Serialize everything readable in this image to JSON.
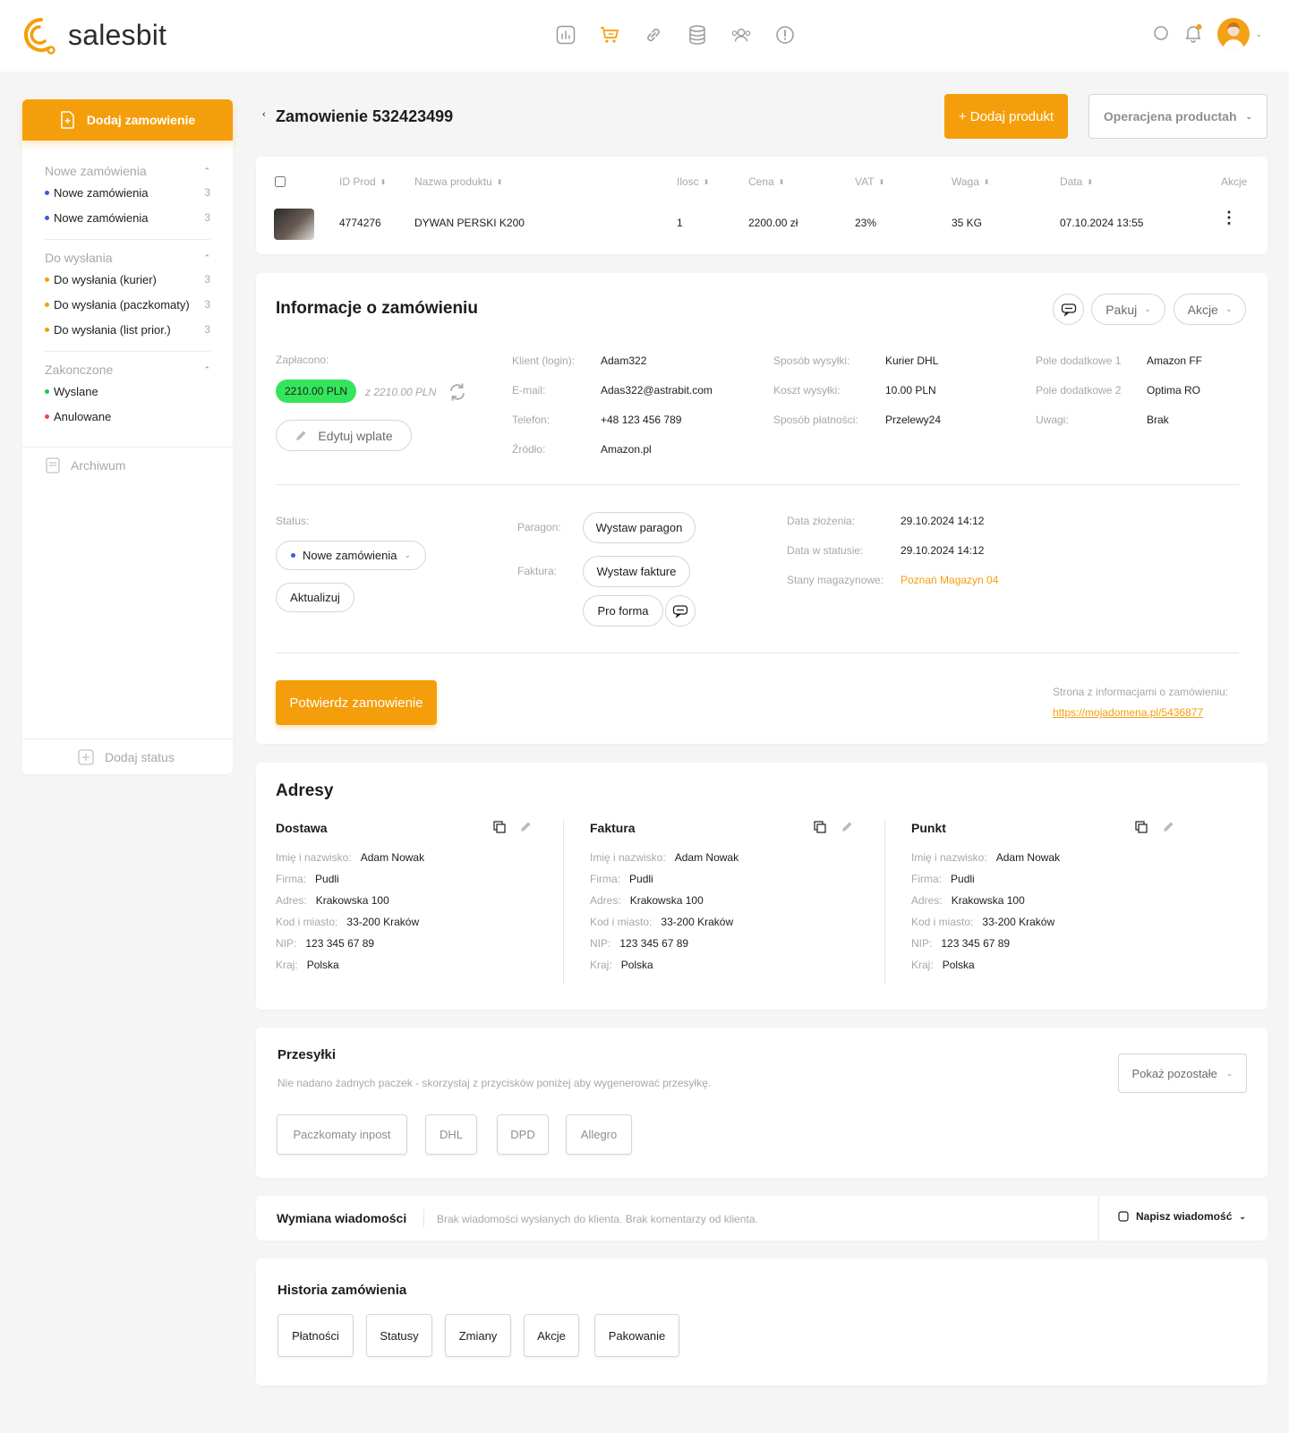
{
  "header": {
    "logo_text": "salesbit",
    "nav_icons": [
      "chart-icon",
      "cart-icon",
      "link-icon",
      "database-icon",
      "users-icon",
      "alert-icon"
    ]
  },
  "sidebar": {
    "add_order": "Dodaj zamowienie",
    "groups": [
      {
        "title": "Nowe zamówienia",
        "items": [
          {
            "label": "Nowe zamówienia",
            "count": "3",
            "color": "#3b5bdb"
          },
          {
            "label": "Nowe zamówienia",
            "count": "3",
            "color": "#3b5bdb"
          }
        ]
      },
      {
        "title": "Do wysłania",
        "items": [
          {
            "label": "Do wysłania (kurier)",
            "count": "3",
            "color": "#f59e0b"
          },
          {
            "label": "Do wysłania (paczkomaty)",
            "count": "3",
            "color": "#f59e0b"
          },
          {
            "label": "Do wysłania (list prior.)",
            "count": "3",
            "color": "#f59e0b"
          }
        ]
      },
      {
        "title": "Zakonczone",
        "items": [
          {
            "label": "Wyslane",
            "count": "",
            "color": "#22c55e"
          },
          {
            "label": "Anulowane",
            "count": "",
            "color": "#ef4444"
          }
        ]
      }
    ],
    "archive": "Archiwum",
    "add_status": "Dodaj status"
  },
  "page": {
    "title": "Zamowienie 532423499",
    "add_product": "+ Dodaj produkt",
    "operations": "Operacjena productah"
  },
  "products": {
    "columns": [
      "ID Prod",
      "Nazwa produktu",
      "Ilosc",
      "Cena",
      "VAT",
      "Waga",
      "Data",
      "Akcje"
    ],
    "rows": [
      {
        "id": "4774276",
        "name": "DYWAN PERSKI K200",
        "qty": "1",
        "price": "2200.00 zł",
        "vat": "23%",
        "weight": "35 KG",
        "date": "07.10.2024 13:55"
      }
    ]
  },
  "info": {
    "title": "Informacje o zamówieniu",
    "pack": "Pakuj",
    "actions": "Akcje",
    "paid_label": "Zapłacono:",
    "paid_amount": "2210.00 PLN",
    "paid_of": "z 2210.00 PLN",
    "edit_payment": "Edytuj wplate",
    "col2": [
      {
        "k": "Klient (login):",
        "v": "Adam322"
      },
      {
        "k": "E-mail:",
        "v": "Adas322@astrabit.com"
      },
      {
        "k": "Telefon:",
        "v": "+48 123 456 789"
      },
      {
        "k": "Źródło:",
        "v": "Amazon.pl"
      }
    ],
    "col3": [
      {
        "k": "Sposób wysyłki:",
        "v": "Kurier DHL"
      },
      {
        "k": "Koszt wysyłki:",
        "v": "10.00 PLN"
      },
      {
        "k": "Sposób płatności:",
        "v": "Przelewy24"
      }
    ],
    "col4": [
      {
        "k": "Pole dodatkowe 1",
        "v": "Amazon FF"
      },
      {
        "k": "Pole dodatkowe 2",
        "v": "Optima RO"
      },
      {
        "k": "Uwagi:",
        "v": "Brak"
      }
    ],
    "status_label": "Status:",
    "status_value": "Nowe zamówienia",
    "update": "Aktualizuj",
    "receipt_label": "Paragon:",
    "receipt_btn": "Wystaw paragon",
    "invoice_label": "Faktura:",
    "invoice_btn": "Wystaw fakture",
    "proforma_btn": "Pro forma",
    "dates": [
      {
        "k": "Data złożenia:",
        "v": "29.10.2024 14:12"
      },
      {
        "k": "Data w statusie:",
        "v": "29.10.2024 14:12"
      },
      {
        "k": "Stany magazynowe:",
        "v": "Poznań Magazyn 04"
      }
    ],
    "confirm": "Potwierdz zamowienie",
    "info_page_label": "Strona z informacjami o zamówieniu:",
    "info_page_url": "https://mojadomena.pl/5436877"
  },
  "addresses": {
    "title": "Adresy",
    "blocks": [
      {
        "title": "Dostawa",
        "rows": [
          {
            "k": "Imię i nazwisko:",
            "v": "Adam Nowak"
          },
          {
            "k": "Firma:",
            "v": "Pudli"
          },
          {
            "k": "Adres:",
            "v": "Krakowska 100"
          },
          {
            "k": "Kod i miasto:",
            "v": "33-200 Kraków"
          },
          {
            "k": "NIP:",
            "v": "123 345 67 89"
          },
          {
            "k": "Kraj:",
            "v": "Polska"
          }
        ]
      },
      {
        "title": "Faktura",
        "rows": [
          {
            "k": "Imię i nazwisko:",
            "v": "Adam Nowak"
          },
          {
            "k": "Firma:",
            "v": "Pudli"
          },
          {
            "k": "Adres:",
            "v": "Krakowska 100"
          },
          {
            "k": "Kod i miasto:",
            "v": "33-200 Kraków"
          },
          {
            "k": "NIP:",
            "v": "123 345 67 89"
          },
          {
            "k": "Kraj:",
            "v": "Polska"
          }
        ]
      },
      {
        "title": "Punkt",
        "rows": [
          {
            "k": "Imię i nazwisko:",
            "v": "Adam Nowak"
          },
          {
            "k": "Firma:",
            "v": "Pudli"
          },
          {
            "k": "Adres:",
            "v": "Krakowska 100"
          },
          {
            "k": "Kod i miasto:",
            "v": "33-200 Kraków"
          },
          {
            "k": "NIP:",
            "v": "123 345 67 89"
          },
          {
            "k": "Kraj:",
            "v": "Polska"
          }
        ]
      }
    ]
  },
  "shipments": {
    "title": "Przesyłki",
    "note": "Nie nadano żadnych paczek - skorzystaj z przycisków poniżej aby wygenerować przesyłkę.",
    "show_more": "Pokaż pozostałe",
    "carriers": [
      "Paczkomaty inpost",
      "DHL",
      "DPD",
      "Allegro"
    ]
  },
  "messages": {
    "title": "Wymiana wiadomości",
    "note": "Brak wiadomości wysłanych do klienta. Brak komentarzy od klienta.",
    "write": "Napisz wiadomość"
  },
  "history": {
    "title": "Historia zamówienia",
    "tabs": [
      "Płatności",
      "Statusy",
      "Zmiany",
      "Akcje",
      "Pakowanie"
    ]
  },
  "colors": {
    "accent": "#f59e0b",
    "paid": "#34e55b",
    "blue_dot": "#3b5bdb",
    "green_dot": "#22c55e",
    "red_dot": "#ef4444"
  }
}
